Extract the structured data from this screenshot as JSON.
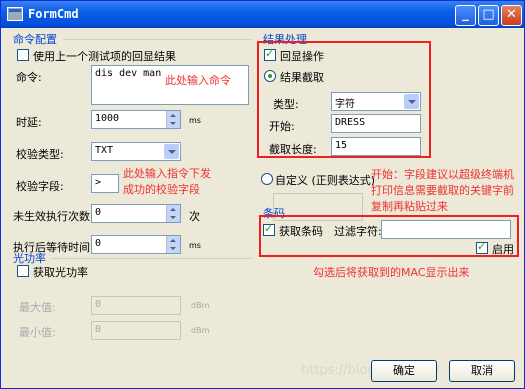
{
  "window": {
    "title": "FormCmd"
  },
  "cmd_group": {
    "title": "命令配置",
    "use_last_label": "使用上一个测试项的回显结果",
    "command_label": "命令:",
    "command_value": "dis dev man",
    "command_note": "此处输入命令",
    "delay_label": "时延:",
    "delay_value": "1000",
    "delay_unit": "ms",
    "check_type_label": "校验类型:",
    "check_type_value": "TXT",
    "check_field_label": "校验字段:",
    "check_field_value": ">",
    "check_field_note": "此处输入指令下发\n成功的校验字段",
    "retry_label": "未生效执行次数:",
    "retry_value": "0",
    "retry_unit": "次",
    "wait_label": "执行后等待时间:",
    "wait_value": "0",
    "wait_unit": "ms"
  },
  "power_group": {
    "title": "光功率",
    "get_power_label": "获取光功率",
    "max_label": "最大值:",
    "max_value": "0",
    "max_unit": "dBm",
    "min_label": "最小值:",
    "min_value": "0",
    "min_unit": "dBm"
  },
  "result_group": {
    "title": "结果处理",
    "echo_label": "回显操作",
    "cut_label": "结果截取",
    "type_label": "类型:",
    "type_value": "字符",
    "start_label": "开始:",
    "start_value": "DRESS",
    "length_label": "截取长度:",
    "length_value": "15",
    "custom_label": "自定义 (正则表达式)",
    "custom_note": "开始：字段建议以超级终端机\n打印信息需要截取的关键字前\n复制再粘贴过来"
  },
  "barcode_group": {
    "title": "条码",
    "get_barcode_label": "获取条码",
    "filter_label": "过滤字符:",
    "filter_value": "",
    "enable_label": "启用",
    "note": "勾选后将获取到的MAC显示出来"
  },
  "buttons": {
    "ok": "确定",
    "cancel": "取消"
  },
  "watermark": "https://blog.csdn.net/"
}
